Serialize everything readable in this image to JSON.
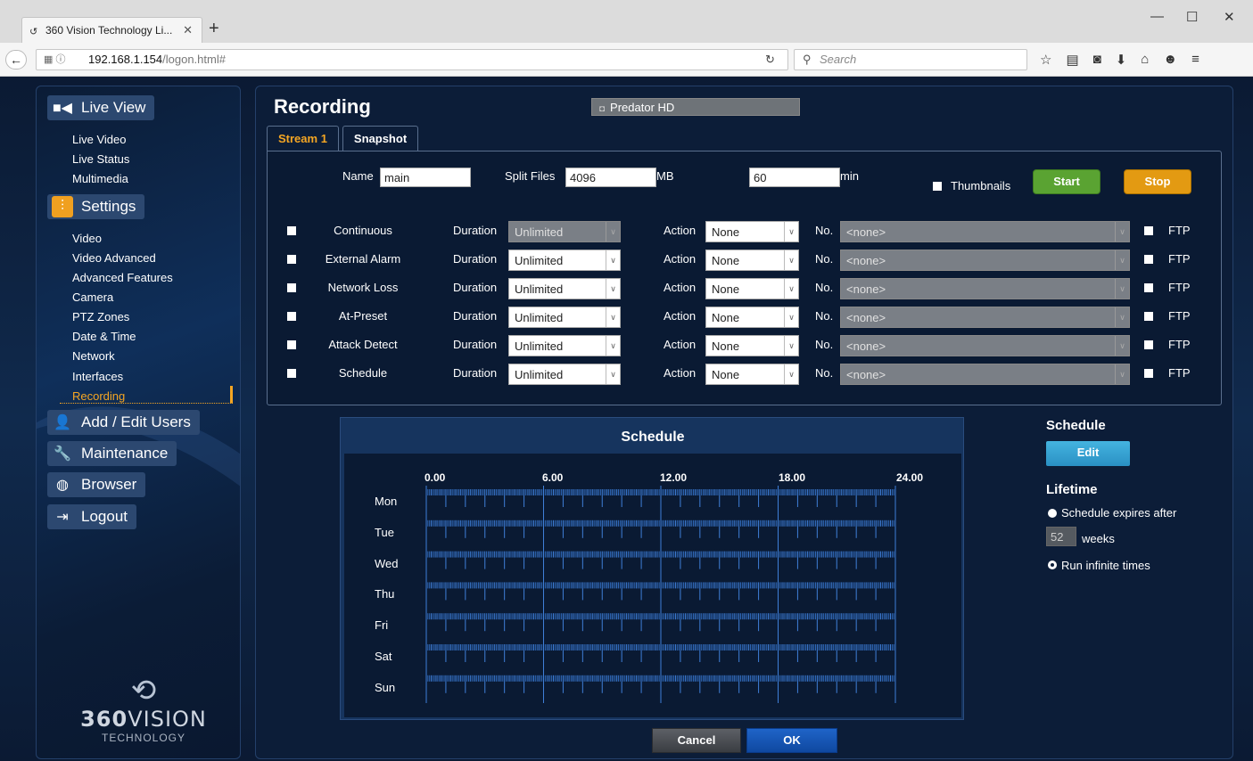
{
  "browser": {
    "tab_title": "360 Vision Technology Li...",
    "url_host": "192.168.1.154",
    "url_path": "/logon.html#",
    "search_placeholder": "Search"
  },
  "sidebar": {
    "sections": [
      {
        "label": "Live View",
        "icon": "video-camera-icon",
        "items": [
          "Live Video",
          "Live Status",
          "Multimedia"
        ]
      },
      {
        "label": "Settings",
        "icon": "sliders-icon",
        "items": [
          "Video",
          "Video Advanced",
          "Advanced Features",
          "Camera",
          "PTZ Zones",
          "Date & Time",
          "Network",
          "Interfaces",
          "Recording"
        ]
      },
      {
        "label": "Add / Edit Users",
        "icon": "add-user-icon"
      },
      {
        "label": "Maintenance",
        "icon": "wrench-icon"
      },
      {
        "label": "Browser",
        "icon": "globe-icon"
      },
      {
        "label": "Logout",
        "icon": "logout-icon"
      }
    ],
    "active_item": "Recording",
    "logo": {
      "brand_bold": "360",
      "brand_thin": "VISION",
      "sub": "TECHNOLOGY"
    }
  },
  "page": {
    "title": "Recording",
    "camera": "Predator HD",
    "tabs": [
      "Stream 1",
      "Snapshot"
    ],
    "active_tab": "Stream 1"
  },
  "stream": {
    "name_label": "Name",
    "name_value": "main",
    "split_label": "Split Files",
    "split_value": "4096",
    "split_unit": "MB",
    "split_time_value": "60",
    "split_time_unit": "min",
    "thumbnails_label": "Thumbnails",
    "start_label": "Start",
    "stop_label": "Stop",
    "duration_label": "Duration",
    "action_label": "Action",
    "no_label": "No.",
    "ftp_label": "FTP",
    "triggers": [
      {
        "label": "Continuous",
        "duration": "Unlimited",
        "duration_disabled": true,
        "action": "None",
        "no": "<none>"
      },
      {
        "label": "External Alarm",
        "duration": "Unlimited",
        "duration_disabled": false,
        "action": "None",
        "no": "<none>"
      },
      {
        "label": "Network Loss",
        "duration": "Unlimited",
        "duration_disabled": false,
        "action": "None",
        "no": "<none>"
      },
      {
        "label": "At-Preset",
        "duration": "Unlimited",
        "duration_disabled": false,
        "action": "None",
        "no": "<none>"
      },
      {
        "label": "Attack Detect",
        "duration": "Unlimited",
        "duration_disabled": false,
        "action": "None",
        "no": "<none>"
      },
      {
        "label": "Schedule",
        "duration": "Unlimited",
        "duration_disabled": false,
        "action": "None",
        "no": "<none>"
      }
    ]
  },
  "schedule": {
    "title": "Schedule",
    "hours": [
      "0.00",
      "6.00",
      "12.00",
      "18.00",
      "24.00"
    ],
    "days": [
      "Mon",
      "Tue",
      "Wed",
      "Thu",
      "Fri",
      "Sat",
      "Sun"
    ]
  },
  "right_panel": {
    "schedule_heading": "Schedule",
    "edit_label": "Edit",
    "lifetime_heading": "Lifetime",
    "expires_label": "Schedule expires after",
    "weeks_value": "52",
    "weeks_label": "weeks",
    "infinite_label": "Run infinite times"
  },
  "footer": {
    "cancel_label": "Cancel",
    "ok_label": "OK"
  },
  "colors": {
    "accent_orange": "#f5a623",
    "start_green": "#5aa332",
    "stop_orange": "#e39a12",
    "ok_blue": "#1f64c8",
    "edit_blue": "#44b4e0"
  }
}
